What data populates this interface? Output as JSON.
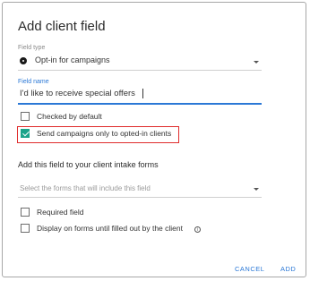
{
  "dialog": {
    "title": "Add client field",
    "field_type": {
      "label": "Field type",
      "value": "Opt-in for campaigns"
    },
    "field_name": {
      "label": "Field name",
      "value": "I'd like to receive special offers"
    },
    "options": [
      {
        "label": "Checked by default",
        "checked": false
      },
      {
        "label": "Send campaigns only to opted-in clients",
        "checked": true
      }
    ],
    "intake_section": {
      "title": "Add this field to your client intake forms",
      "forms_placeholder": "Select the forms that will include this field",
      "options": [
        {
          "label": "Required field",
          "checked": false
        },
        {
          "label": "Display on forms until filled out by the client",
          "checked": false,
          "icon": "info-icon"
        }
      ]
    },
    "buttons": {
      "cancel": "CANCEL",
      "add": "ADD"
    }
  },
  "colors": {
    "accent": "#2b78d6",
    "checkbox_checked": "#1ba38a",
    "highlight_border": "#e02c2c"
  }
}
